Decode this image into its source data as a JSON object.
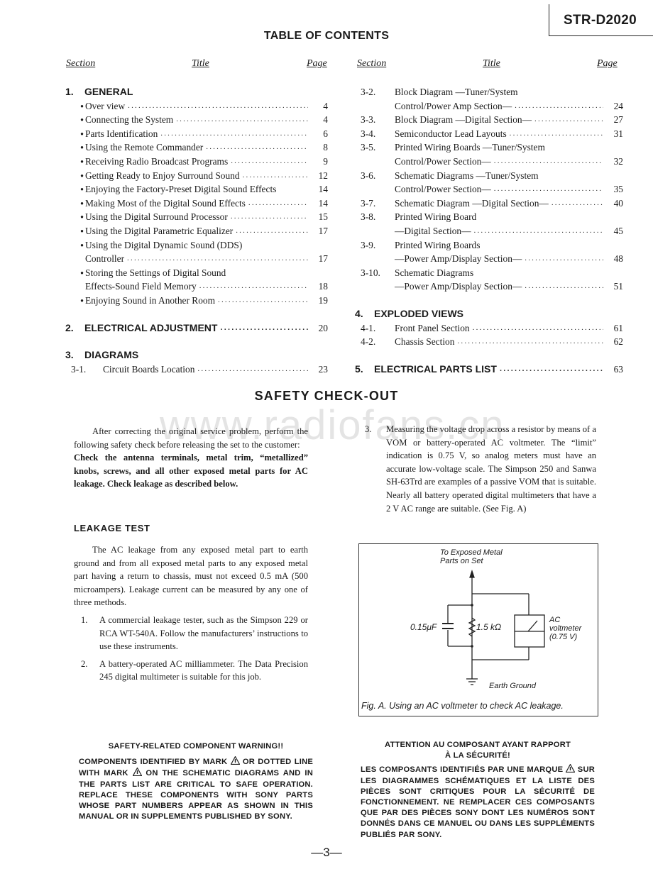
{
  "model": "STR-D2020",
  "toc": {
    "title": "TABLE OF CONTENTS",
    "headers": {
      "section": "Section",
      "title": "Title",
      "page": "Page"
    },
    "left": [
      {
        "type": "heading",
        "num": "1.",
        "text": "GENERAL",
        "page": ""
      },
      {
        "type": "bullet",
        "text": "Over view",
        "page": "4"
      },
      {
        "type": "bullet",
        "text": "Connecting the System",
        "page": "4"
      },
      {
        "type": "bullet",
        "text": "Parts Identification",
        "page": "6"
      },
      {
        "type": "bullet",
        "text": "Using the Remote Commander",
        "page": "8"
      },
      {
        "type": "bullet",
        "text": "Receiving Radio Broadcast Programs",
        "page": "9"
      },
      {
        "type": "bullet",
        "text": "Getting Ready to Enjoy Surround Sound",
        "page": "12"
      },
      {
        "type": "bullet",
        "text": "Enjoying the Factory-Preset Digital Sound Effects",
        "page": "14",
        "nodots": true
      },
      {
        "type": "bullet",
        "text": "Making Most of the Digital Sound Effects",
        "page": "14"
      },
      {
        "type": "bullet",
        "text": "Using the Digital Surround Processor",
        "page": "15"
      },
      {
        "type": "bullet",
        "text": "Using the Digital Parametric Equalizer",
        "page": "17"
      },
      {
        "type": "bullet",
        "text": "Using the Digital Dynamic Sound (DDS)",
        "page": "",
        "nodots": true
      },
      {
        "type": "cont",
        "text": "Controller",
        "page": "17"
      },
      {
        "type": "bullet",
        "text": "Storing the Settings of Digital Sound",
        "page": "",
        "nodots": true
      },
      {
        "type": "cont",
        "text": "Effects-Sound Field Memory",
        "page": "18"
      },
      {
        "type": "bullet",
        "text": "Enjoying Sound in Another Room",
        "page": "19"
      },
      {
        "type": "heading",
        "num": "2.",
        "text": "ELECTRICAL ADJUSTMENT",
        "page": "20",
        "gap": true
      },
      {
        "type": "heading",
        "num": "3.",
        "text": "DIAGRAMS",
        "page": "",
        "gap": true
      },
      {
        "type": "sub",
        "num": "3-1.",
        "text": "Circuit Boards Location",
        "page": "23"
      }
    ],
    "right": [
      {
        "type": "sub",
        "num": "3-2.",
        "text": "Block Diagram —Tuner/System",
        "page": "",
        "nodots": true
      },
      {
        "type": "subcont",
        "text": "Control/Power Amp Section—",
        "page": "24"
      },
      {
        "type": "sub",
        "num": "3-3.",
        "text": "Block Diagram —Digital Section—",
        "page": "27"
      },
      {
        "type": "sub",
        "num": "3-4.",
        "text": "Semiconductor Lead Layouts",
        "page": "31"
      },
      {
        "type": "sub",
        "num": "3-5.",
        "text": "Printed Wiring Boards —Tuner/System",
        "page": "",
        "nodots": true
      },
      {
        "type": "subcont",
        "text": "Control/Power Section—",
        "page": "32"
      },
      {
        "type": "sub",
        "num": "3-6.",
        "text": "Schematic Diagrams —Tuner/System",
        "page": "",
        "nodots": true
      },
      {
        "type": "subcont",
        "text": "Control/Power Section—",
        "page": "35"
      },
      {
        "type": "sub",
        "num": "3-7.",
        "text": "Schematic Diagram —Digital Section—",
        "page": "40"
      },
      {
        "type": "sub",
        "num": "3-8.",
        "text": "Printed Wiring Board",
        "page": "",
        "nodots": true
      },
      {
        "type": "subcont",
        "text": "—Digital Section—",
        "page": "45"
      },
      {
        "type": "sub",
        "num": "3-9.",
        "text": "Printed Wiring Boards",
        "page": "",
        "nodots": true
      },
      {
        "type": "subcont",
        "text": "—Power Amp/Display Section—",
        "page": "48"
      },
      {
        "type": "sub",
        "num": "3-10.",
        "text": "Schematic Diagrams",
        "page": "",
        "nodots": true
      },
      {
        "type": "subcont",
        "text": "—Power Amp/Display Section—",
        "page": "51"
      },
      {
        "type": "heading",
        "num": "4.",
        "text": "EXPLODED VIEWS",
        "page": "",
        "gap": true
      },
      {
        "type": "sub",
        "num": "4-1.",
        "text": "Front Panel Section",
        "page": "61"
      },
      {
        "type": "sub",
        "num": "4-2.",
        "text": "Chassis Section",
        "page": "62"
      },
      {
        "type": "heading",
        "num": "5.",
        "text": "ELECTRICAL PARTS LIST",
        "page": "63",
        "gap": true
      }
    ]
  },
  "safety": {
    "title": "SAFETY CHECK-OUT",
    "watermark": "www.radiofans.cn",
    "intro": "After correcting the original service problem, perform the following safety check before releasing the set to the customer:",
    "intro_bold": "Check the antenna terminals, metal trim, “metallized” knobs, screws, and all other exposed metal parts for AC leakage. Check leakage as described below.",
    "leakage_heading": "LEAKAGE TEST",
    "leakage_para": "The AC leakage from any exposed metal part to earth ground and from all exposed metal parts to any exposed metal part having a return to chassis, must not exceed 0.5 mA (500 microampers). Leakage current can be measured by any one of three methods.",
    "methods": [
      {
        "num": "1.",
        "text": "A commercial leakage tester, such as the Simpson 229 or RCA WT-540A. Follow the manufacturers’ instructions to use these instruments."
      },
      {
        "num": "2.",
        "text": "A battery-operated AC milliammeter. The Data Precision 245 digital multimeter is suitable for this job."
      },
      {
        "num": "3.",
        "text": "Measuring the voltage drop across a resistor by means of a VOM or battery-operated AC voltmeter. The “limit” indication is 0.75 V, so analog meters must have an accurate low-voltage scale. The Simpson 250 and Sanwa SH-63Trd are examples of a passive VOM that is suitable. Nearly all battery operated digital multimeters that have a 2 V AC range are suitable. (See Fig. A)"
      }
    ],
    "figure": {
      "top_label_1": "To Exposed Metal",
      "top_label_2": "Parts on Set",
      "capacitor": "0.15μF",
      "resistor": "1.5 kΩ",
      "meter_1": "AC",
      "meter_2": "voltmeter",
      "meter_3": "(0.75 V)",
      "ground": "Earth Ground",
      "caption": "Fig. A.   Using an AC voltmeter to check AC leakage."
    }
  },
  "warning_en": {
    "title": "SAFETY-RELATED COMPONENT WARNING!!",
    "p1": "COMPONENTS IDENTIFIED BY MARK",
    "p2": "OR DOTTED LINE WITH MARK",
    "p3": "ON THE SCHEMATIC DIAGRAMS AND IN THE PARTS LIST ARE CRITICAL TO SAFE OPERATION. REPLACE THESE COMPONENTS WITH SONY PARTS WHOSE PART NUMBERS APPEAR AS SHOWN IN THIS MANUAL OR IN SUPPLEMENTS PUBLISHED BY SONY."
  },
  "warning_fr": {
    "title_1": "ATTENTION AU COMPOSANT AYANT RAPPORT",
    "title_2": "À LA SÉCURITÉ!",
    "p1": "LES COMPOSANTS IDENTIFIÉS PAR UNE MARQUE",
    "p2": "SUR LES DIAGRAMMES SCHÉMATIQUES ET LA LISTE DES PIÈCES SONT CRITIQUES POUR LA SÉCURITÉ DE FONCTIONNEMENT. NE REMPLACER CES COMPOSANTS QUE PAR DES PIÈCES SONY DONT LES NUMÉROS SONT DONNÉS DANS CE MANUEL OU DANS LES SUPPLÉMENTS PUBLIÉS PAR SONY."
  },
  "page_number": "—3—"
}
